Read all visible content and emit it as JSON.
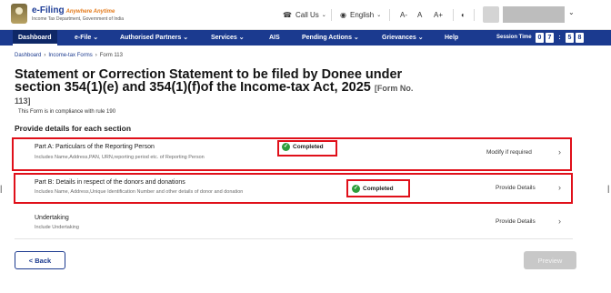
{
  "header": {
    "logo_title": "e-Filing",
    "logo_tagline": "Anywhere Anytime",
    "logo_sub": "Income Tax Department, Government of India",
    "call_us": "Call Us",
    "language": "English",
    "font_sizes": [
      "A-",
      "A",
      "A+"
    ]
  },
  "nav": {
    "items": [
      "Dashboard",
      "e-File",
      "Authorised Partners",
      "Services",
      "AIS",
      "Pending Actions",
      "Grievances",
      "Help"
    ],
    "session_label": "Session Time",
    "session_digits": [
      "0",
      "7",
      ":",
      "5",
      "8"
    ]
  },
  "breadcrumb": [
    "Dashboard",
    "Income-tax Forms",
    "Form 113"
  ],
  "page": {
    "title": "Statement or Correction Statement to be filed by Donee under section 354(1)(e) and 354(1)(f)of the Income-tax Act, 2025",
    "form_no": "[Form No. 113]",
    "compliance": "This Form is in compliance with rule 190",
    "section_heading": "Provide details for each section"
  },
  "rows": [
    {
      "title": "Part A: Particulars of the Reporting Person",
      "subtitle": "Includes Name,Address,PAN, URN,reporting period etc. of Reporting Person",
      "status": "Completed",
      "action": "Modify if required"
    },
    {
      "title": "Part B: Details in respect of the donors and donations",
      "subtitle": "Includes Name, Address,Unique Identification Number and other details of donor and donation",
      "status": "Completed",
      "action": "Provide Details"
    },
    {
      "title": "Undertaking",
      "subtitle": "Include Undertaking",
      "status": "",
      "action": "Provide Details"
    }
  ],
  "buttons": {
    "back": "< Back",
    "preview": "Preview"
  },
  "colors": {
    "nav_bg": "#1b3a8f",
    "highlight_box": "#e0101a",
    "completed_check": "#2e9e3c"
  }
}
